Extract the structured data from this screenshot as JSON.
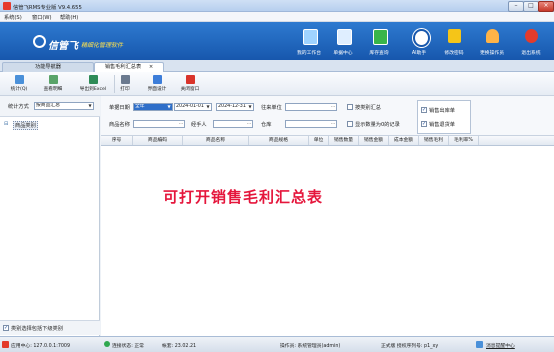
{
  "window": {
    "title": "信管飞RMS专业版 V9.4.655",
    "min": "–",
    "max": "□",
    "close": "×"
  },
  "menu": [
    "系统(S)",
    "窗口(W)",
    "帮助(H)"
  ],
  "banner": {
    "logo": "信管飞",
    "slogan": "精细化管理软件"
  },
  "toolbar_main": [
    {
      "label": "我的工作台",
      "color": "#9fd3ff"
    },
    {
      "label": "单据中心",
      "color": "#dfeeff"
    },
    {
      "label": "库存查询",
      "color": "#39b54a"
    },
    {
      "label": "AI助手",
      "color": "#ffffff"
    },
    {
      "label": "修改密码",
      "color": "#f5c518"
    },
    {
      "label": "更换操作员",
      "color": "#ffb347"
    },
    {
      "label": "退出系统",
      "color": "#e33b2b"
    }
  ],
  "tabs": {
    "home": "功能导航器",
    "active": "销售毛利汇总表",
    "close": "×"
  },
  "toolbar": [
    {
      "label": "统计(Q)",
      "color": "#4a90d9"
    },
    {
      "label": "查看明细",
      "color": "#5aa469"
    },
    {
      "label": "导出到Excel",
      "color": "#2e8b57"
    },
    {
      "label": "打印",
      "color": "#6b7a8f"
    },
    {
      "label": "界面设计",
      "color": "#3c7dd9"
    },
    {
      "label": "关闭窗口",
      "color": "#d9342b"
    }
  ],
  "left": {
    "mode_label": "统计方式",
    "mode_value": "按商品汇总",
    "tree_root": "商品类别",
    "footer_check": "类别选择包括下级类别"
  },
  "filter": {
    "date_label": "单据日期",
    "period": "全年",
    "date_from": "2024-01-01",
    "date_to": "2024-12-31",
    "partner_label": "往来单位",
    "by_category": "按类别汇总",
    "product_label": "商品名称",
    "handler_label": "经手人",
    "warehouse_label": "仓库",
    "show_zero": "显示数量为0的记录",
    "opt_out": "销售出库单",
    "opt_return": "销售退货单"
  },
  "grid": {
    "columns": [
      "序号",
      "商品编码",
      "商品名称",
      "商品规格",
      "单位",
      "销售数量",
      "销售金额",
      "成本金额",
      "销售毛利",
      "毛利率%"
    ]
  },
  "overlay_text": "可打开销售毛利汇总表",
  "status": {
    "app_center": "应用中心: 127.0.0.1:7009",
    "conn": "连接状态: 正常",
    "account": "帐套: 23.02.21",
    "operator": "操作员: 系统管理员(admin)",
    "license": "正式版 授权序列号: p1_xy",
    "msg_center": "消息提醒中心"
  }
}
